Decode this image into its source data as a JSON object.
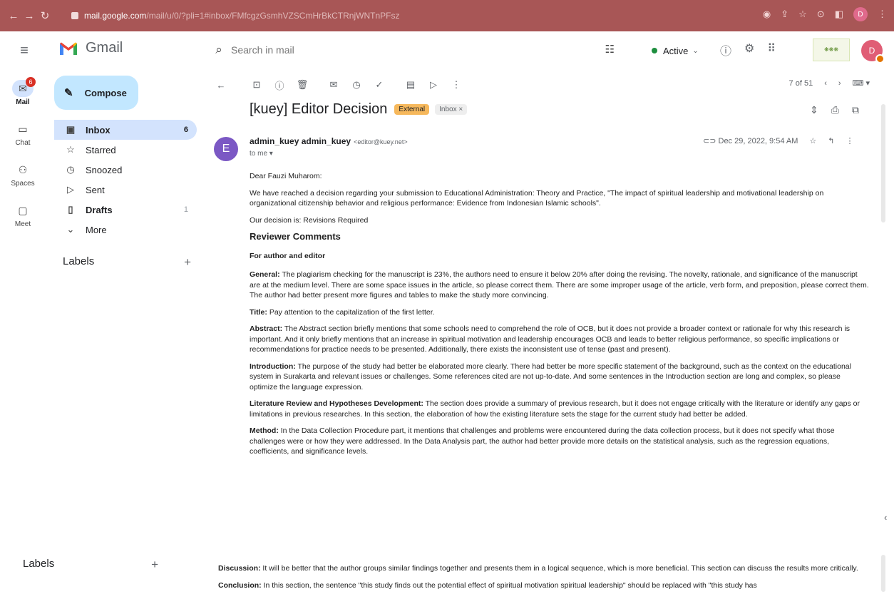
{
  "browser": {
    "url_host": "mail.google.com",
    "url_path": "/mail/u/0/?pli=1#inbox/FMfcgzGsmhVZSCmHrBkCTRnjWNTnPFsz",
    "profile_initial": "D"
  },
  "header": {
    "app_name": "Gmail",
    "search_placeholder": "Search in mail",
    "status_label": "Active",
    "avatar_initial": "D"
  },
  "rail": {
    "items": [
      {
        "label": "Mail",
        "badge": "6"
      },
      {
        "label": "Chat"
      },
      {
        "label": "Spaces"
      },
      {
        "label": "Meet"
      }
    ]
  },
  "sidebar": {
    "compose_label": "Compose",
    "items": [
      {
        "label": "Inbox",
        "count": "6"
      },
      {
        "label": "Starred"
      },
      {
        "label": "Snoozed"
      },
      {
        "label": "Sent"
      },
      {
        "label": "Drafts",
        "count": "1"
      },
      {
        "label": "More"
      }
    ],
    "labels_heading": "Labels",
    "labels_add": "+"
  },
  "toolbar": {
    "pager_text": "7 of 51"
  },
  "email": {
    "subject": "[kuey] Editor Decision",
    "chip_external": "External",
    "chip_inbox": "Inbox ×",
    "sender_initial": "E",
    "sender_name": "admin_kuey admin_kuey",
    "sender_email": "<editor@kuey.net>",
    "to_line": "to me ▾",
    "date": "Dec 29, 2022, 9:54 AM",
    "greeting": "Dear Fauzi Muharom:",
    "intro": "We have reached a decision regarding your submission to Educational Administration: Theory and Practice, \"The impact of spiritual leadership and motivational leadership on organizational citizenship behavior and religious performance: Evidence from Indonesian Islamic schools\".",
    "decision": "Our decision is: Revisions Required",
    "reviewer_heading": "Reviewer Comments",
    "for_author_heading": "For author and editor",
    "sections": [
      {
        "label": "General:",
        "text": " The plagiarism checking for the manuscript is 23%, the authors need to ensure it below 20% after doing the revising. The novelty, rationale, and significance of the manuscript are at the medium level. There are some space issues in the article, so please correct them. There are some improper usage of the article, verb form, and preposition, please correct them. The author had better present more figures and tables to make the study more convincing."
      },
      {
        "label": "Title:",
        "text": " Pay attention to the capitalization of the first letter."
      },
      {
        "label": "Abstract:",
        "text": " The Abstract section briefly mentions that some schools need to comprehend the role of OCB, but it does not provide a broader context or rationale for why this research is important. And it only briefly mentions that an increase in spiritual motivation and leadership encourages OCB and leads to better religious performance, so specific implications or recommendations for practice needs to be presented. Additionally, there exists the inconsistent use of tense (past and present)."
      },
      {
        "label": "Introduction:",
        "text": " The purpose of the study had better be elaborated more clearly. There had better be more specific statement of the background, such as the context on the educational system in Surakarta and relevant issues or challenges. Some references cited are not up-to-date. And some sentences in the Introduction section are long and complex, so please optimize the language expression."
      },
      {
        "label": "Literature Review and Hypotheses Development:",
        "text": " The section does provide a summary of previous research, but it does not engage critically with the literature or identify any gaps or limitations in previous researches. In this section, the elaboration of how the existing literature sets the stage for the current study had better be added."
      },
      {
        "label": "Method:",
        "text": " In the Data Collection Procedure part, it mentions that challenges and problems were encountered during the data collection process, but it does not specify what those challenges were or how they were addressed. In the Data Analysis part, the author had better provide more details on the statistical analysis, such as the regression equations, coefficients, and significance levels."
      }
    ],
    "sections2": [
      {
        "label": "Discussion:",
        "text": " It will be better that the author groups similar findings together and presents them in a logical sequence, which is more beneficial. This section can discuss the results more critically."
      },
      {
        "label": "Conclusion:",
        "text": " In this section, the sentence \"this study finds out the potential effect of spiritual motivation spiritual leadership\" should be replaced with \"this study has"
      }
    ]
  }
}
